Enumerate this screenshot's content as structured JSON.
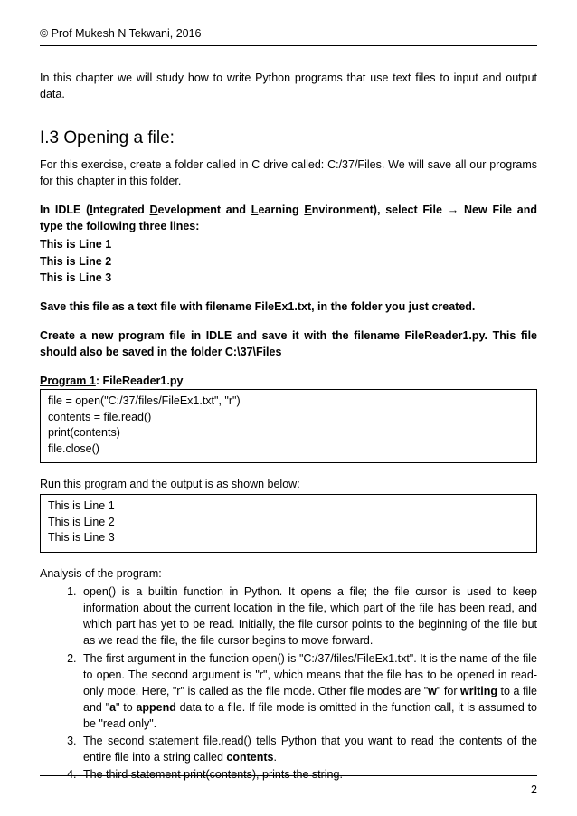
{
  "header": {
    "copyright": "© Prof Mukesh N Tekwani, 2016"
  },
  "intro": "In this chapter we will study how to write Python programs that use text files to input and output data.",
  "section": {
    "heading": "I.3 Opening a file:",
    "p1": "For this exercise, create a folder called in C drive called: C:/37/Files. We will save all our programs for this chapter in this folder.",
    "idle_prefix": "In IDLE (",
    "idle_ide_I": "I",
    "idle_ide_rest": "ntegrated ",
    "idle_D": "D",
    "idle_dev_rest": "evelopment and ",
    "idle_L": "L",
    "idle_learn_rest": "earning ",
    "idle_E": "E",
    "idle_env_rest": "nvironment), select File → New File and type the following three lines:",
    "l1": "This is Line 1",
    "l2": "This is Line 2",
    "l3": "This is Line 3",
    "save_txt": "Save this file as a text file with filename FileEx1.txt, in the folder you just created.",
    "create_prog": "Create a new program file in IDLE and save it with the filename FileReader1.py. This file should also be saved in the folder C:\\37\\Files",
    "prog_label_u": "Program 1",
    "prog_label_post": ": FileReader1.py",
    "code": {
      "c1": "file = open(\"C:/37/files/FileEx1.txt\", \"r\")",
      "c2": "contents = file.read()",
      "c3": "print(contents)",
      "c4": "file.close()"
    },
    "run_line": "Run this program and the output is as shown below:",
    "output": {
      "o1": "This is Line 1",
      "o2": "This is Line 2",
      "o3": "This is Line 3"
    },
    "analysis_head": "Analysis of the program:",
    "analysis": {
      "a1": "open() is a builtin function in Python. It opens a file; the  file cursor is used to keep information about the current location in the file, which part of the file has been read, and which part has yet to be read. Initially, the file cursor points to the beginning of the file but as we read the file, the file cursor begins to move forward.",
      "a2_pre": "The first argument in the function open() is \"C:/37/files/FileEx1.txt\". It is the name of the file to open. The second argument is \"r\", which means that the file has to be opened in read-only mode. Here, \"r\" is called as the file mode. Other file modes are \"",
      "a2_w": "w",
      "a2_mid1": "\" for ",
      "a2_writing": "writing",
      "a2_mid2": " to a file and \"",
      "a2_a": "a",
      "a2_mid3": "\" to ",
      "a2_append": "append",
      "a2_post": " data to a file.  If file mode is omitted in the function call, it is assumed to  be \"read only\".",
      "a3_pre": "The second statement file.read() tells Python that you want to read the contents of the entire file into a string called ",
      "a3_contents": "contents",
      "a3_post": ".",
      "a4": "The third statement print(contents), prints the string."
    }
  },
  "footer": {
    "page": "2"
  }
}
